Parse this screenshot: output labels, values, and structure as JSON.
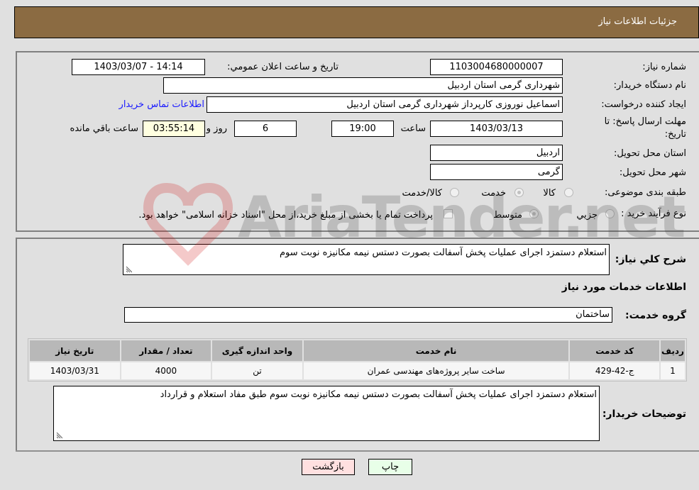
{
  "header": {
    "title": "جزئیات اطلاعات نیاز"
  },
  "form": {
    "need_number": {
      "label": "شماره نیاز:",
      "value": "1103004680000007"
    },
    "announce_datetime": {
      "label": "تاریخ و ساعت اعلان عمومي:",
      "value": "1403/03/07 - 14:14"
    },
    "buyer_org": {
      "label": "نام دستگاه خريدار:",
      "value": "شهرداری گرمی استان اردبیل"
    },
    "creator": {
      "label": "ایجاد کننده درخواست:",
      "value": "اسماعیل نوروزی کارپرداز شهرداری گرمی استان اردبیل"
    },
    "contact_link": "اطلاعات تماس خريدار",
    "deadline": {
      "label_line1": "مهلت ارسال پاسخ: تا",
      "label_line2": "تاریخ:",
      "date": "1403/03/13",
      "time_label": "ساعت",
      "time": "19:00",
      "days": "6",
      "days_label": "روز و",
      "remaining": "03:55:14",
      "remaining_label": "ساعت باقي مانده"
    },
    "delivery_province": {
      "label": "استان محل تحویل:",
      "value": "اردبیل"
    },
    "delivery_city": {
      "label": "شهر محل تحویل:",
      "value": "گرمی"
    },
    "category": {
      "label": "طبقه بندی موضوعی:",
      "options": [
        "کالا",
        "خدمت",
        "کالا/خدمت"
      ],
      "selected": "خدمت"
    },
    "purchase_type": {
      "label": "نوع فرآیند خرید :",
      "options": [
        "جزيي",
        "متوسط"
      ],
      "selected": "متوسط",
      "treasury_note": "پرداخت تمام یا بخشی از مبلغ خرید،از محل \"اسناد خزانه اسلامی\" خواهد بود."
    }
  },
  "details": {
    "general_desc": {
      "label": "شرح کلي نیاز:",
      "value": "استعلام دستمزد اجرای عملیات پخش آسفالت بصورت دستس نیمه مکانیزه نوبت سوم"
    },
    "services_heading": "اطلاعات خدمات مورد نیاز",
    "service_group": {
      "label": "گروه خدمت:",
      "value": "ساختمان"
    },
    "table": {
      "headers": [
        "ردیف",
        "کد خدمت",
        "نام خدمت",
        "واحد اندازه گیری",
        "تعداد / مقدار",
        "تاریخ نیاز"
      ],
      "rows": [
        [
          "1",
          "ج-42-429",
          "ساخت سایر پروژه‌های مهندسی عمران",
          "تن",
          "4000",
          "1403/03/31"
        ]
      ]
    },
    "buyer_notes": {
      "label": "توضیحات خریدار:",
      "value": "استعلام دستمزد اجرای عملیات پخش آسفالت بصورت دستس نیمه مکانیزه نوبت سوم طبق مفاد استعلام و قرارداد"
    }
  },
  "buttons": {
    "print": "چاپ",
    "back": "بازگشت"
  },
  "watermark": "AriaTender.net"
}
